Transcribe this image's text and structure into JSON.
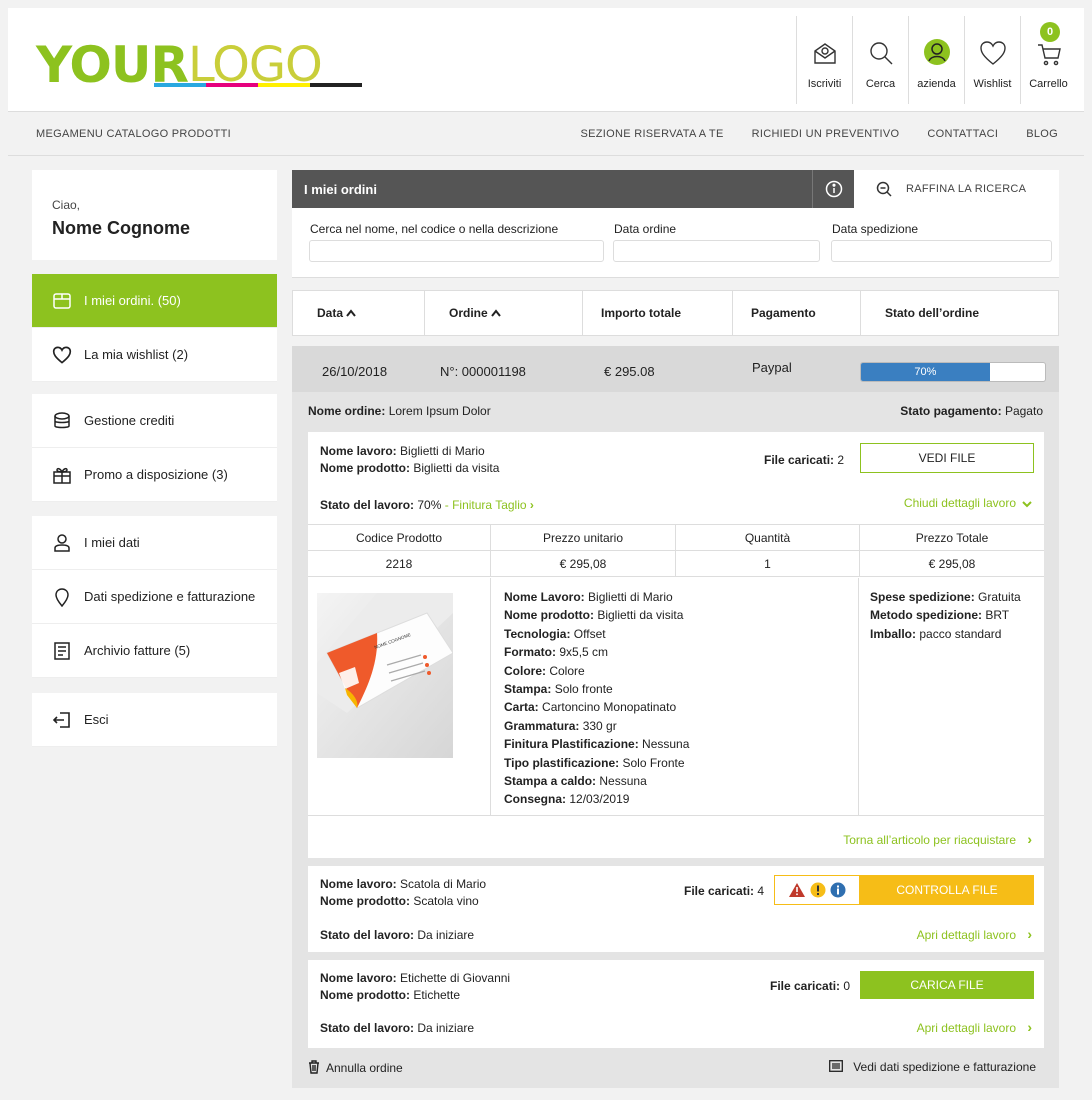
{
  "header": {
    "logo": {
      "bold": "YOUR",
      "thin": "LOGO"
    },
    "logo_bar_colors": [
      "#29a8e0",
      "#e6007e",
      "#fff000",
      "#222222"
    ],
    "icons": [
      {
        "label": "Iscriviti",
        "icon": "newsletter-icon"
      },
      {
        "label": "Cerca",
        "icon": "search-icon"
      },
      {
        "label": "azienda",
        "icon": "user-icon"
      },
      {
        "label": "Wishlist",
        "icon": "heart-icon"
      },
      {
        "label": "Carrello",
        "icon": "cart-icon",
        "badge": "0"
      }
    ]
  },
  "nav": {
    "megamenu": "MEGAMENU CATALOGO PRODOTTI",
    "links": [
      "SEZIONE RISERVATA A TE",
      "RICHIEDI UN PREVENTIVO",
      "CONTATTACI",
      "BLOG"
    ]
  },
  "sidebar": {
    "greeting": "Ciao,",
    "user_name": "Nome Cognome",
    "items": [
      {
        "label": "I miei ordini. (50)",
        "icon": "box-icon",
        "active": true
      },
      {
        "label": "La mia wishlist  (2)",
        "icon": "heart-icon"
      },
      {
        "label": "Gestione crediti",
        "icon": "coins-icon"
      },
      {
        "label": "Promo a  disposizione  (3)",
        "icon": "gift-icon"
      },
      {
        "label": "I miei dati",
        "icon": "user-icon"
      },
      {
        "label": "Dati spedizione e fatturazione",
        "icon": "location-icon"
      },
      {
        "label": "Archivio fatture  (5)",
        "icon": "invoice-icon"
      },
      {
        "label": "Esci",
        "icon": "logout-icon"
      }
    ]
  },
  "orders": {
    "title": "I miei ordini",
    "refine": "RAFFINA LA RICERCA",
    "filters": {
      "search_label": "Cerca nel nome, nel codice o nella descrizione",
      "date_label": "Data ordine",
      "ship_label": "Data spedizione"
    },
    "columns": [
      "Data",
      "Ordine",
      "Importo totale",
      "Pagamento",
      "Stato dell’ordine"
    ],
    "order": {
      "date": "26/10/2018",
      "number": "N°: 000001198",
      "total": "€ 295.08",
      "payment": "Paypal",
      "progress_label": "70%",
      "progress": 0.7,
      "name_label": "Nome ordine:",
      "name": "Lorem Ipsum Dolor",
      "pay_status_label": "Stato pagamento:",
      "pay_status": "Pagato"
    }
  },
  "job1": {
    "work_label": "Nome lavoro:",
    "work": "Biglietti di Mario",
    "product_label": "Nome prodotto:",
    "product": "Biglietti da visita",
    "files_label": "File caricati:",
    "files": "2",
    "button": "VEDI FILE",
    "status_label": "Stato del lavoro:",
    "status": "70%",
    "status_sep": "-",
    "phase": "Finitura Taglio",
    "toggle": "Chiudi dettagli lavoro",
    "table_headers": [
      "Codice Prodotto",
      "Prezzo unitario",
      "Quantità",
      "Prezzo Totale"
    ],
    "table_row": [
      "2218",
      "€ 295,08",
      "1",
      "€ 295,08"
    ],
    "card_name": "NOME COGNOME",
    "specs": [
      {
        "k": "Nome Lavoro:",
        "v": "Biglietti di Mario"
      },
      {
        "k": "Nome prodotto:",
        "v": "Biglietti da visita"
      },
      {
        "k": "Tecnologia:",
        "v": "Offset"
      },
      {
        "k": "Formato:",
        "v": "9x5,5 cm"
      },
      {
        "k": "Colore:",
        "v": "Colore"
      },
      {
        "k": "Stampa:",
        "v": "Solo fronte"
      },
      {
        "k": "Carta:",
        "v": "Cartoncino Monopatinato"
      },
      {
        "k": "Grammatura:",
        "v": " 330 gr"
      },
      {
        "k": "Finitura Plastificazione:",
        "v": "Nessuna"
      },
      {
        "k": "Tipo plastificazione:",
        "v": "Solo Fronte"
      },
      {
        "k": "Stampa a caldo:",
        "v": "Nessuna"
      },
      {
        "k": "Consegna:",
        "v": "12/03/2019"
      }
    ],
    "shipping": [
      {
        "k": "Spese spedizione:",
        "v": "Gratuita"
      },
      {
        "k": "Metodo spedizione:",
        "v": "BRT"
      },
      {
        "k": "Imballo:",
        "v": "pacco standard"
      }
    ],
    "rebuy": "Torna all’articolo per riacquistare"
  },
  "job2": {
    "work_label": "Nome lavoro:",
    "work": "Scatola di Mario",
    "product_label": "Nome prodotto:",
    "product": "Scatola vino",
    "files_label": "File caricati:",
    "files": "4",
    "button": "CONTROLLA FILE",
    "status_label": "Stato del lavoro:",
    "status": "Da iniziare",
    "toggle": "Apri dettagli lavoro"
  },
  "job3": {
    "work_label": "Nome lavoro:",
    "work": "Etichette di Giovanni",
    "product_label": "Nome prodotto:",
    "product": "Etichette",
    "files_label": "File caricati:",
    "files": "0",
    "button": "CARICA FILE",
    "status_label": "Stato del lavoro:",
    "status": "Da iniziare",
    "toggle": "Apri dettagli lavoro"
  },
  "footer": {
    "cancel": "Annulla ordine",
    "shipping_data": "Vedi dati spedizione e fatturazione"
  },
  "colors": {
    "accent": "#8dc21f",
    "warning": "#f6bd17",
    "progress": "#3a7fc1",
    "danger": "#c0392b",
    "info": "#2f6fb0"
  }
}
